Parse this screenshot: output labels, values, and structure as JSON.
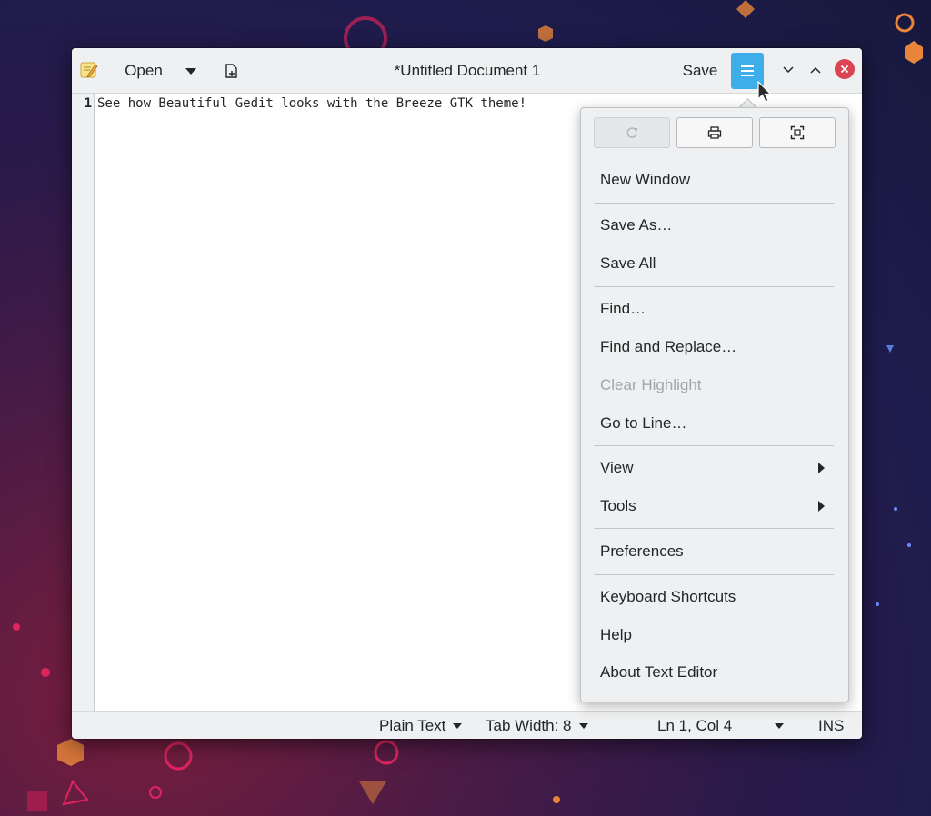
{
  "window": {
    "title": "*Untitled Document 1",
    "open_label": "Open",
    "save_label": "Save"
  },
  "editor": {
    "line_number": "1",
    "line_text": "See how Beautiful Gedit looks with the Breeze GTK theme!"
  },
  "statusbar": {
    "language": "Plain Text",
    "tab_width": "Tab Width: 8",
    "position": "Ln 1, Col 4",
    "mode": "INS"
  },
  "menu": {
    "icon_buttons": [
      {
        "icon": "reload-icon",
        "enabled": false
      },
      {
        "icon": "print-icon",
        "enabled": true
      },
      {
        "icon": "fullscreen-icon",
        "enabled": true
      }
    ],
    "items": {
      "new_window": "New Window",
      "save_as": "Save As…",
      "save_all": "Save All",
      "find": "Find…",
      "find_replace": "Find and Replace…",
      "clear_highlight": "Clear Highlight",
      "go_to_line": "Go to Line…",
      "view": "View",
      "tools": "Tools",
      "preferences": "Preferences",
      "keyboard_shortcuts": "Keyboard Shortcuts",
      "help": "Help",
      "about": "About Text Editor"
    }
  },
  "colors": {
    "accent": "#3daee9",
    "close": "#da4453",
    "window_bg": "#eff0f1",
    "text": "#232627",
    "disabled_text": "#a2a5a8"
  }
}
